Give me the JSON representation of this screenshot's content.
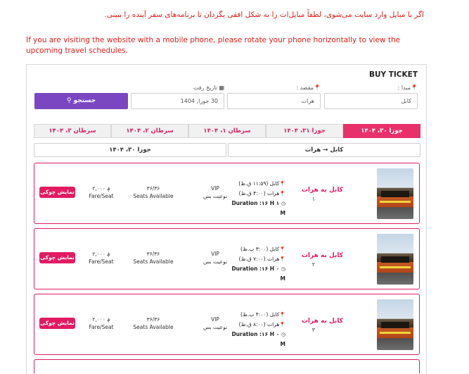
{
  "notice": {
    "fa": "اگر با مبایل وارد سایت می‌شوی، لطفاً مبایل‌ات را به شکل افقی بگردان تا برنامه‌های سفر آینده را ببینی.",
    "en": "If you are visiting the website with a mobile phone, please rotate your phone horizontally to view the upcoming travel schedules."
  },
  "booking": {
    "title": "BUY TICKET",
    "origin_label": "مبدا :",
    "origin_value": "کابل",
    "destination_label": "مقصد :",
    "destination_value": "هرات",
    "date_label": "تاریخ رفت",
    "date_value": "30 جوزا, 1404",
    "search_label": "جستجو"
  },
  "date_tabs": [
    {
      "label": "جوزا ۳۰، ۱۴۰۴",
      "active": true
    },
    {
      "label": "جوزا ۳۱، ۱۴۰۴",
      "active": false
    },
    {
      "label": "سرطان ۱، ۱۴۰۴",
      "active": false
    },
    {
      "label": "سرطان ۲، ۱۴۰۴",
      "active": false
    },
    {
      "label": "سرطان ۳، ۱۴۰۴",
      "active": false
    }
  ],
  "route_bar": {
    "from": "کابل",
    "arrow": "→",
    "to": "هرات",
    "date": "جوزا ۳۰، ۱۴۰۴"
  },
  "trips": [
    {
      "route": "کابل به هرات",
      "num": "۱",
      "depart": "کابل (۱۱:۵۹ ق.ظ)",
      "arrive": "هرات (۴:۰۰ ق.ظ)",
      "duration": "Duration :۱۶ H ۱ M",
      "bus_class": "VIP",
      "bus_type": "نوعیت بس",
      "seats": "۳۶/۳۶",
      "seats_label": "Seats Available",
      "fare": "۲,۰۰۰ ؋",
      "fare_label": "Fare/Seat",
      "button": "نمایش چوکی"
    },
    {
      "route": "کابل به هرات",
      "num": "۲",
      "depart": "کابل (۳:۰۰ ب.ظ)",
      "arrive": "هرات (۷:۰۰ ق.ظ)",
      "duration": "Duration :۱۶ H ۰ M",
      "bus_class": "VIP",
      "bus_type": "نوعیت بس",
      "seats": "۳۶/۳۶",
      "seats_label": "Seats Available",
      "fare": "۲,۰۰۰ ؋",
      "fare_label": "Fare/Seat",
      "button": "نمایش چوکی"
    },
    {
      "route": "کابل به هرات",
      "num": "۳",
      "depart": "کابل (۴:۰۰ ب.ظ)",
      "arrive": "هرات (۸:۰۰ ق.ظ)",
      "duration": "Duration :۱۶ H ۰ M",
      "bus_class": "VIP",
      "bus_type": "نوعیت بس",
      "seats": "۳۶/۳۶",
      "seats_label": "Seats Available",
      "fare": "۲,۰۰۰ ؋",
      "fare_label": "Fare/Seat",
      "button": "نمایش چوکی"
    }
  ],
  "colors": {
    "accent": "#e11b62",
    "button_purple": "#7a47c1",
    "notice_red": "#e0201b"
  }
}
